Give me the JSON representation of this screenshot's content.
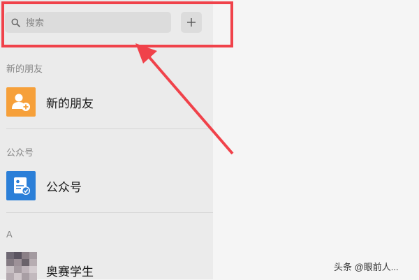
{
  "search": {
    "placeholder": "搜索"
  },
  "sections": {
    "new_friends_header": "新的朋友",
    "official_header": "公众号",
    "letter_header": "A"
  },
  "rows": {
    "new_friends": {
      "label": "新的朋友",
      "icon": "add-friend-icon",
      "icon_color": "#f6a03a"
    },
    "official": {
      "label": "公众号",
      "icon": "official-account-icon",
      "icon_color": "#2b7fd8"
    },
    "contact": {
      "label": "奥赛学生",
      "icon": "pixelated-avatar"
    }
  },
  "annotation": {
    "color": "#f0424a"
  },
  "watermark": {
    "text": "头条 @眼前人..."
  }
}
